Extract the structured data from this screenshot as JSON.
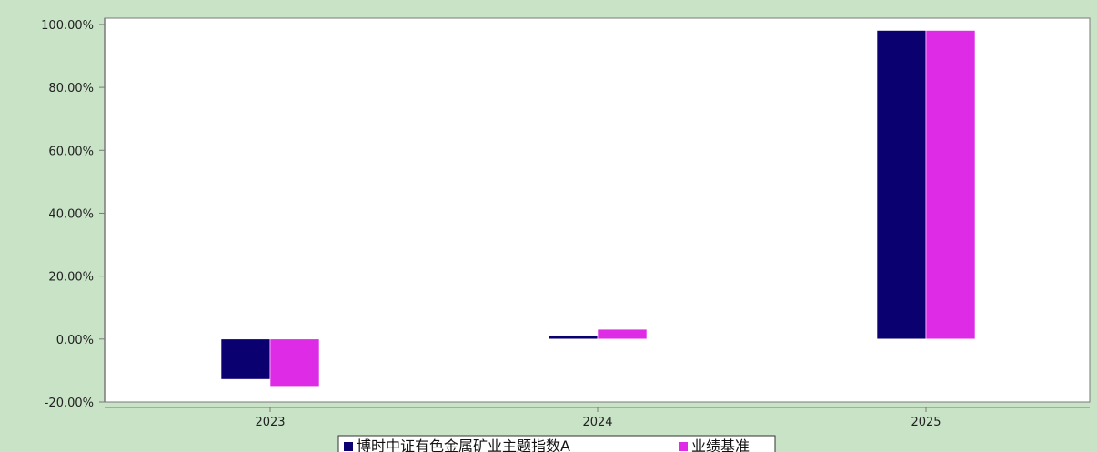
{
  "colors": {
    "background": "#c8e3c6",
    "plot_background": "#ffffff",
    "axis": "#7a7a7a",
    "series_fund": "#0b006f",
    "series_benchmark": "#dd2be6"
  },
  "chart_data": {
    "type": "bar",
    "title": "",
    "xlabel": "",
    "ylabel": "",
    "categories": [
      "2023",
      "2024",
      "2025"
    ],
    "series": [
      {
        "name": "博时中证有色金属矿业主题指数A",
        "values": [
          -12.8,
          1.2,
          98.1
        ],
        "color": "#0b006f"
      },
      {
        "name": "业绩基准",
        "values": [
          -15.0,
          3.1,
          98.1
        ],
        "color": "#dd2be6"
      }
    ],
    "ylim": [
      -20,
      100
    ],
    "yticks": [
      -20,
      0,
      20,
      40,
      60,
      80,
      100
    ],
    "ytick_labels": [
      "-20.00%",
      "0.00%",
      "20.00%",
      "40.00%",
      "60.00%",
      "80.00%",
      "100.00%"
    ],
    "grid": false,
    "legend_position": "bottom-center"
  }
}
